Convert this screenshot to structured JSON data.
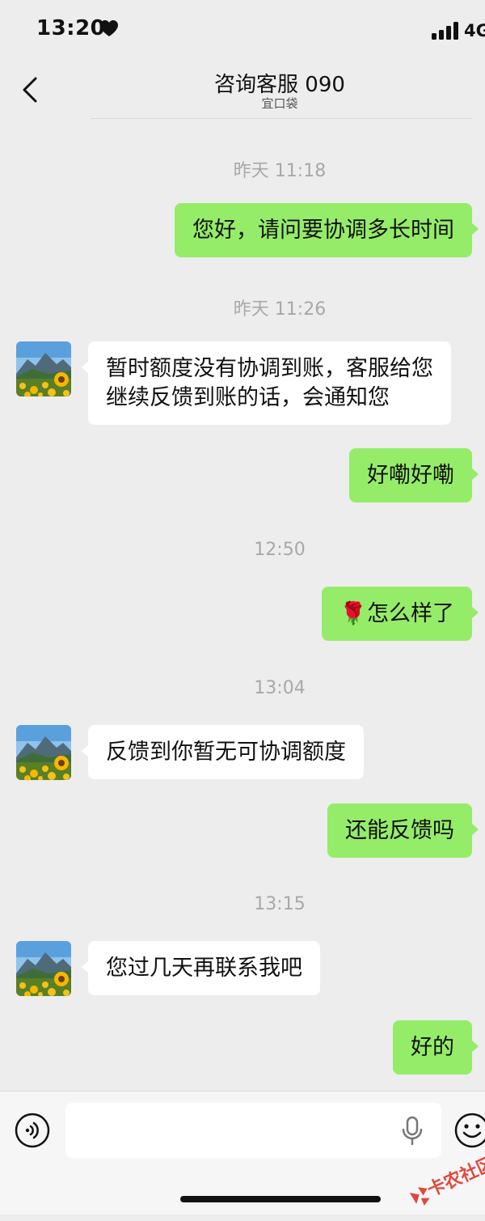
{
  "status_bar": {
    "time": "13:20",
    "heart_icon": "heart-icon",
    "signal_icon": "signal-icon",
    "network": "4G"
  },
  "nav": {
    "back_icon": "chevron-left-icon",
    "title": "咨询客服 090",
    "subtitle": "宜口袋"
  },
  "messages": [
    {
      "type": "time",
      "text": "昨天 11:18"
    },
    {
      "type": "sent",
      "text": "您好，请问要协调多长时间"
    },
    {
      "type": "time",
      "text": "昨天 11:26"
    },
    {
      "type": "received",
      "lines": [
        "暂时额度没有协调到账，客服给您",
        "继续反馈到账的话，会通知您"
      ]
    },
    {
      "type": "sent",
      "text": "好嘞好嘞"
    },
    {
      "type": "time",
      "text": "12:50"
    },
    {
      "type": "sent",
      "emoji": "🌹",
      "text": "怎么样了"
    },
    {
      "type": "time",
      "text": "13:04"
    },
    {
      "type": "received",
      "text": "反馈到你暂无可协调额度"
    },
    {
      "type": "sent",
      "text": "还能反馈吗"
    },
    {
      "type": "time",
      "text": "13:15"
    },
    {
      "type": "received",
      "text": "您过几天再联系我吧"
    },
    {
      "type": "sent",
      "text": "好的"
    }
  ],
  "input_bar": {
    "voice_icon": "voice-icon",
    "input_value": "",
    "mic_icon": "mic-icon",
    "emoji_icon": "smiley-icon"
  },
  "watermark": {
    "text": "卡农社区"
  },
  "colors": {
    "background": "#ededed",
    "sent_bubble": "#95ec69",
    "received_bubble": "#ffffff",
    "timestamp": "#a8a8a8",
    "watermark": "#e0483e"
  }
}
